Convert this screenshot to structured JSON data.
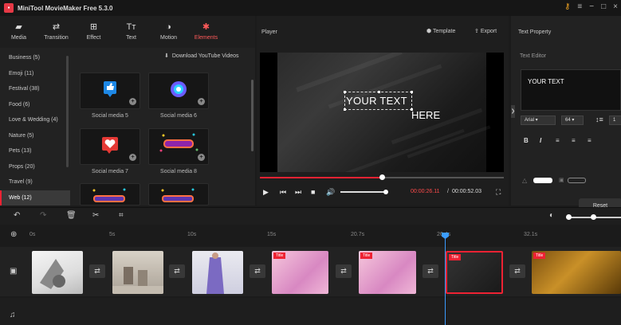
{
  "app": {
    "title": "MiniTool MovieMaker Free 5.3.0"
  },
  "toolbar": {
    "tabs": [
      {
        "label": "Media",
        "icon": "folder-icon"
      },
      {
        "label": "Transition",
        "icon": "transition-icon"
      },
      {
        "label": "Effect",
        "icon": "effect-icon"
      },
      {
        "label": "Text",
        "icon": "text-icon"
      },
      {
        "label": "Motion",
        "icon": "motion-icon"
      },
      {
        "label": "Elements",
        "icon": "elements-icon",
        "active": true
      }
    ]
  },
  "categories": [
    {
      "label": "Business (5)"
    },
    {
      "label": "Emoji (11)"
    },
    {
      "label": "Festival (38)"
    },
    {
      "label": "Food (6)"
    },
    {
      "label": "Love & Wedding (4)"
    },
    {
      "label": "Nature (5)"
    },
    {
      "label": "Pets (13)"
    },
    {
      "label": "Props (20)"
    },
    {
      "label": "Travel (9)"
    },
    {
      "label": "Web (12)",
      "active": true
    }
  ],
  "elements_panel": {
    "download_link": "Download YouTube Videos",
    "items": [
      {
        "label": "Social media 5"
      },
      {
        "label": "Social media 6"
      },
      {
        "label": "Social media 7"
      },
      {
        "label": "Social media 8"
      },
      {
        "label": ""
      },
      {
        "label": ""
      }
    ]
  },
  "player": {
    "title": "Player",
    "template_label": "Template",
    "export_label": "Export",
    "preview_text": "YOUR TEXT",
    "preview_text_2": "HERE",
    "current_time": "00:00:26.11",
    "separator": "/",
    "total_time": "00:00:52.03",
    "progress": 0.5,
    "volume": 0.93
  },
  "property": {
    "title": "Text Property",
    "editor_label": "Text Editor",
    "editor_value": "YOUR TEXT",
    "font": "Arial",
    "font_size": "64",
    "line_spacing": "1",
    "reset_label": "Reset"
  },
  "timeline": {
    "ticks": [
      "0s",
      "5s",
      "10s",
      "15s",
      "20.7s",
      "26.4s",
      "32.1s"
    ],
    "title_tag": "Title",
    "zoom": 0.45
  },
  "colors": {
    "accent": "#ee2233",
    "playhead": "#3b9cff"
  }
}
